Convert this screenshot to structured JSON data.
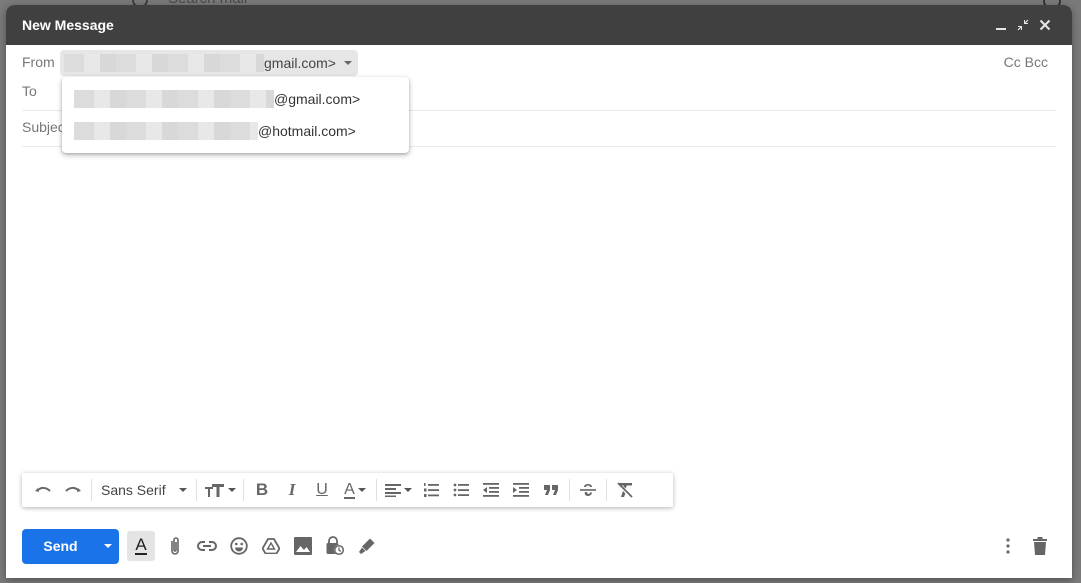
{
  "background": {
    "search_placeholder": "Search mail"
  },
  "compose": {
    "title": "New Message",
    "window_controls": [
      "minimize",
      "exit-full-screen",
      "close"
    ],
    "from": {
      "label": "From",
      "value_suffix": "gmail.com>",
      "value_redacted": true
    },
    "from_options": [
      {
        "suffix": "@gmail.com>",
        "redacted": true
      },
      {
        "suffix": "@hotmail.com>",
        "redacted": true
      }
    ],
    "cc_bcc_label": "Cc Bcc",
    "to": {
      "label": "To",
      "value": ""
    },
    "subject": {
      "label": "Subject",
      "value": ""
    },
    "body": ""
  },
  "formatting_toolbar": {
    "font_family": "Sans Serif",
    "buttons": [
      "undo",
      "redo",
      "font-family",
      "font-size",
      "bold",
      "italic",
      "underline",
      "text-color",
      "align",
      "numbered-list",
      "bulleted-list",
      "indent-less",
      "indent-more",
      "quote",
      "strikethrough",
      "remove-formatting"
    ],
    "bold_glyph": "B",
    "italic_glyph": "I",
    "underline_glyph": "U",
    "text_color_glyph": "A"
  },
  "bottom_toolbar": {
    "send_label": "Send",
    "formatting_glyph": "A",
    "buttons": [
      "formatting-options",
      "attach-files",
      "insert-link",
      "insert-emoji",
      "insert-drive",
      "insert-photo",
      "confidential-mode",
      "insert-signature",
      "more-options",
      "discard-draft"
    ]
  },
  "colors": {
    "titlebar": "#404040",
    "send": "#1a73e8",
    "icon": "#666666"
  }
}
